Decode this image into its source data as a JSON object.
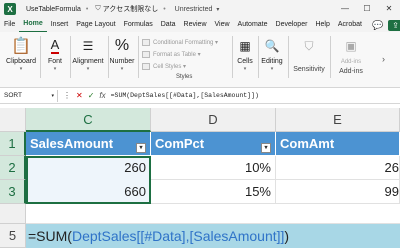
{
  "titlebar": {
    "doc_name": "UseTableFormula",
    "sensitivity_label": "アクセス制限なし",
    "status": "Unrestricted",
    "controls": [
      "—",
      "☐",
      "✕"
    ]
  },
  "menu": {
    "items": [
      "File",
      "Home",
      "Insert",
      "Page Layout",
      "Formulas",
      "Data",
      "Review",
      "View",
      "Automate",
      "Developer",
      "Help",
      "Acrobat"
    ],
    "active": "Home"
  },
  "ribbon": {
    "clipboard": "Clipboard",
    "font": "Font",
    "alignment": "Alignment",
    "number": "Number",
    "number_symbol": "%",
    "conditional_formatting": "Conditional Formatting ▾",
    "format_as_table": "Format as Table ▾",
    "cell_styles": "Cell Styles ▾",
    "styles": "Styles",
    "cells": "Cells",
    "editing": "Editing",
    "sensitivity": "Sensitivity",
    "addins_btn": "Add-ins",
    "addins": "Add-ins"
  },
  "formula_bar": {
    "name_box": "SORT",
    "formula": "=SUM(DeptSales[[#Data],[SalesAmount]])",
    "fx": "fx"
  },
  "grid": {
    "columns": [
      "C",
      "D",
      "E"
    ],
    "rows": [
      "1",
      "2",
      "3",
      "5"
    ],
    "header_cells": [
      "SalesAmount",
      "ComPct",
      "ComAmt"
    ],
    "row2": [
      "260",
      "10%",
      "26"
    ],
    "row3": [
      "660",
      "15%",
      "99"
    ],
    "formula_parts": {
      "prefix": "=SUM(",
      "ref": "DeptSales[[#Data],[SalesAmount]]",
      "suffix": ")"
    }
  },
  "colors": {
    "accent": "#1d6f42",
    "table_header": "#4c93d2",
    "formula_row": "#a8d7e6"
  }
}
